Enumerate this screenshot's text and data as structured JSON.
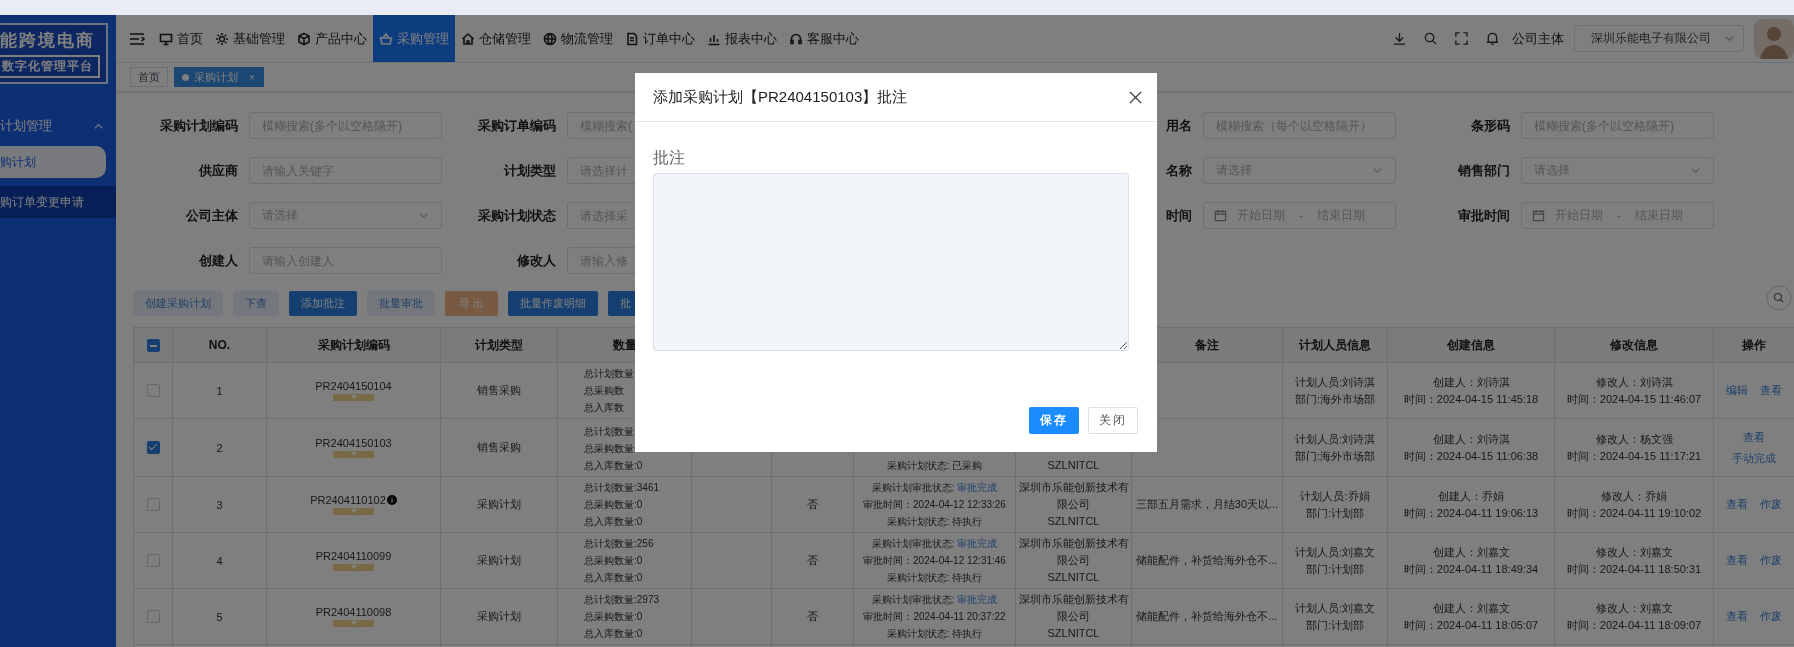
{
  "logo": {
    "title": "能跨境电商",
    "subtitle": "数字化管理平台"
  },
  "sidebar": {
    "group": {
      "label": "计划管理",
      "expanded": true
    },
    "items": [
      {
        "label": "购计划",
        "selected": true
      },
      {
        "label": "购订单变更申请",
        "selected": false
      }
    ]
  },
  "nav": {
    "items": [
      {
        "label": "首页",
        "selected": false
      },
      {
        "label": "基础管理",
        "selected": false
      },
      {
        "label": "产品中心",
        "selected": false
      },
      {
        "label": "采购管理",
        "selected": true
      },
      {
        "label": "仓储管理",
        "selected": false
      },
      {
        "label": "物流管理",
        "selected": false
      },
      {
        "label": "订单中心",
        "selected": false
      },
      {
        "label": "报表中心",
        "selected": false
      },
      {
        "label": "客服中心",
        "selected": false
      }
    ]
  },
  "header_right": {
    "company_label": "公司主体",
    "company_select": "深圳乐能电子有限公司"
  },
  "tabs": [
    {
      "label": "首页",
      "selected": false
    },
    {
      "label": "采购计划",
      "selected": true,
      "close": "×"
    }
  ],
  "filters": [
    {
      "left": [
        {
          "label": "采购计划编码",
          "kind": "text",
          "placeholder": "模糊搜索(多个以空格隔开)"
        },
        {
          "label": "采购订单编码",
          "kind": "text",
          "placeholder": "模糊搜索("
        }
      ],
      "right": [
        {
          "label": "用名",
          "kind": "text",
          "placeholder": "模糊搜索（每个以空格隔开）"
        },
        {
          "label": "条形码",
          "kind": "text",
          "placeholder": "模糊搜索(多个以空格隔开)"
        }
      ]
    },
    {
      "left": [
        {
          "label": "供应商",
          "kind": "text",
          "placeholder": "请输入关键字"
        },
        {
          "label": "计划类型",
          "kind": "text",
          "placeholder": "请选择计"
        }
      ],
      "right": [
        {
          "label": "名称",
          "kind": "select",
          "placeholder": "请选择"
        },
        {
          "label": "销售部门",
          "kind": "select",
          "placeholder": "请选择"
        }
      ]
    },
    {
      "left": [
        {
          "label": "公司主体",
          "kind": "select",
          "placeholder": "请选择"
        },
        {
          "label": "采购计划状态",
          "kind": "text",
          "placeholder": "请选择采"
        }
      ],
      "right": [
        {
          "label": "时间",
          "kind": "daterange",
          "start_placeholder": "开始日期",
          "separator": "-",
          "end_placeholder": "结束日期"
        },
        {
          "label": "审批时间",
          "kind": "daterange",
          "start_placeholder": "开始日期",
          "separator": "-",
          "end_placeholder": "结束日期"
        }
      ]
    },
    {
      "left": [
        {
          "label": "创建人",
          "kind": "text",
          "placeholder": "请输入创建人"
        },
        {
          "label": "修改人",
          "kind": "text",
          "placeholder": "请输入修"
        }
      ]
    }
  ],
  "buttons": [
    {
      "label": "创建采购计划",
      "kind": "light"
    },
    {
      "label": "下查",
      "kind": "light"
    },
    {
      "label": "添加批注",
      "kind": "primary"
    },
    {
      "label": "批量审批",
      "kind": "light"
    },
    {
      "label": "导 出",
      "kind": "warning"
    },
    {
      "label": "批量作废明细",
      "kind": "primary"
    },
    {
      "label": "批",
      "kind": "primary"
    }
  ],
  "table": {
    "header_checkbox": {
      "indeterminate": true
    },
    "columns_left": [
      {
        "label": "NO."
      },
      {
        "label": "采购计划编码"
      },
      {
        "label": "计划类型"
      },
      {
        "label": "数量"
      }
    ],
    "columns_right": [
      {
        "label": "备注"
      },
      {
        "label": "计划人员信息"
      },
      {
        "label": "创建信息"
      },
      {
        "label": "修改信息"
      },
      {
        "label": "操作"
      }
    ],
    "rows": [
      {
        "checked": false,
        "no": "1",
        "code": "PR2404150104",
        "info": false,
        "type": "销售采购",
        "qty": [
          "总计划数量",
          "总采购数",
          "总入库数"
        ],
        "planner": [
          "计划人员:刘诗淇",
          "部门:海外市场部"
        ],
        "created": [
          "创建人：刘诗淇",
          "时间：2024-04-15 11:45:18"
        ],
        "modified": [
          "修改人：刘诗淇",
          "时间：2024-04-15 11:46:07"
        ],
        "actions": [
          "编辑",
          "查看"
        ]
      },
      {
        "checked": true,
        "top_hidden": true,
        "no": "2",
        "code": "PR2404150103",
        "info": false,
        "type": "销售采购",
        "qty": [
          "总计划数量",
          "总采购数量",
          "总入库数量:0"
        ],
        "status": [
          {
            "text": "采购计划状态: 已采购"
          }
        ],
        "company": [
          "SZLNITCL"
        ],
        "planner": [
          "计划人员:刘诗淇",
          "部门:海外市场部"
        ],
        "created": [
          "创建人：刘诗淇",
          "时间：2024-04-15 11:06:38"
        ],
        "modified": [
          "修改人：杨文强",
          "时间：2024-04-15 11:17:21"
        ],
        "actions": [
          "查看",
          "手动完成"
        ]
      },
      {
        "checked": false,
        "no": "3",
        "code": "PR2404110102",
        "info": true,
        "type": "采购计划",
        "qty": [
          "总计划数量:3461",
          "总采购数量:0",
          "总入库数量:0"
        ],
        "flag": "否",
        "status": [
          {
            "text": "采购计划审批状态: ",
            "link": "审批完成"
          },
          {
            "text": "审批时间：2024-04-12 12:33:26"
          },
          {
            "text": "采购计划状态: 待执行"
          }
        ],
        "company": [
          "深圳市乐能创新技术有限公司",
          "SZLNITCL"
        ],
        "remark": "三部五月需求，月结30天以...",
        "planner": [
          "计划人员:乔娟",
          "部门:计划部"
        ],
        "created": [
          "创建人：乔娟",
          "时间：2024-04-11 19:06:13"
        ],
        "modified": [
          "修改人：乔娟",
          "时间：2024-04-11 19:10:02"
        ],
        "actions": [
          "查看",
          "作废"
        ]
      },
      {
        "checked": false,
        "no": "4",
        "code": "PR2404110099",
        "info": false,
        "type": "采购计划",
        "qty": [
          "总计划数量:256",
          "总采购数量:0",
          "总入库数量:0"
        ],
        "flag": "否",
        "status": [
          {
            "text": "采购计划审批状态: ",
            "link": "审批完成"
          },
          {
            "text": "审批时间：2024-04-12 12:31:46"
          },
          {
            "text": "采购计划状态: 待执行"
          }
        ],
        "company": [
          "深圳市乐能创新技术有限公司",
          "SZLNITCL"
        ],
        "remark": "储能配件，补货给海外仓不...",
        "planner": [
          "计划人员:刘嘉文",
          "部门:计划部"
        ],
        "created": [
          "创建人：刘嘉文",
          "时间：2024-04-11 18:49:34"
        ],
        "modified": [
          "修改人：刘嘉文",
          "时间：2024-04-11 18:50:31"
        ],
        "actions": [
          "查看",
          "作废"
        ]
      },
      {
        "checked": false,
        "no": "5",
        "code": "PR2404110098",
        "info": false,
        "type": "采购计划",
        "qty": [
          "总计划数量:2973",
          "总采购数量:0",
          "总入库数量:0"
        ],
        "flag": "否",
        "status": [
          {
            "text": "采购计划审批状态: ",
            "link": "审批完成"
          },
          {
            "text": "审批时间：2024-04-11 20:37:22"
          },
          {
            "text": "采购计划状态: 待执行"
          }
        ],
        "company": [
          "深圳市乐能创新技术有限公司",
          "SZLNITCL"
        ],
        "remark": "储能配件，补货给海外仓不...",
        "planner": [
          "计划人员:刘嘉文",
          "部门:计划部"
        ],
        "created": [
          "创建人：刘嘉文",
          "时间：2024-04-11 18:05:07"
        ],
        "modified": [
          "修改人：刘嘉文",
          "时间：2024-04-11 18:09:07"
        ],
        "actions": [
          "查看",
          "作废"
        ]
      }
    ]
  },
  "dialog": {
    "title": "添加采购计划【PR2404150103】批注",
    "field_label": "批注",
    "buttons": [
      {
        "label": "保存",
        "kind": "primary"
      },
      {
        "label": "关闭",
        "kind": "default"
      }
    ]
  }
}
